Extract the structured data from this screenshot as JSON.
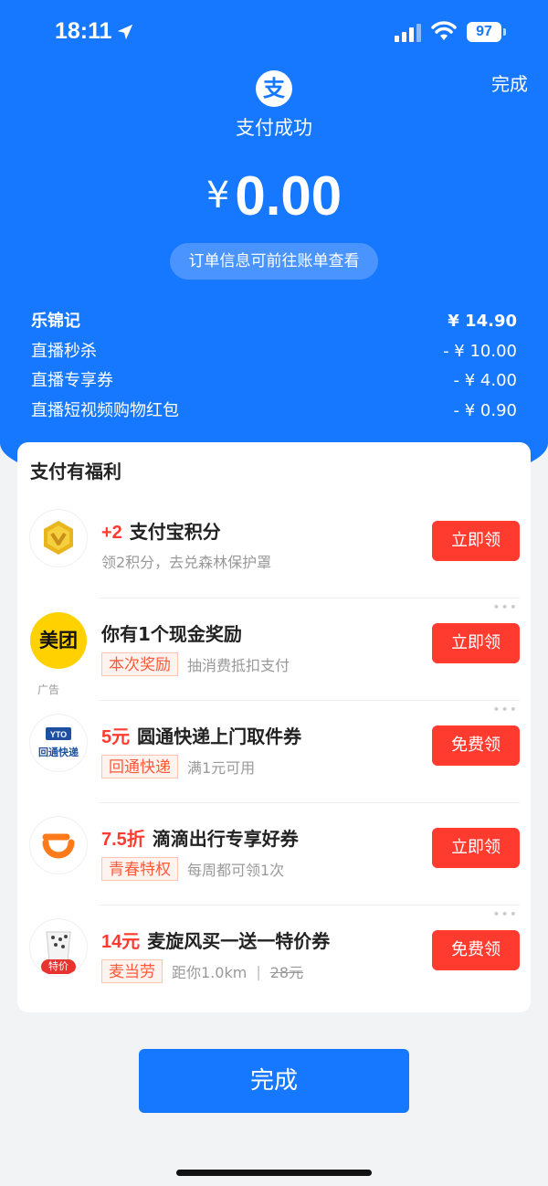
{
  "status_bar": {
    "time": "18:11",
    "battery": "97"
  },
  "header": {
    "done_label": "完成",
    "logo_char": "支",
    "title": "支付成功",
    "currency": "¥",
    "amount": "0.00",
    "bill_hint": "订单信息可前往账单查看"
  },
  "breakdown": [
    {
      "label": "乐锦记",
      "value": "¥ 14.90"
    },
    {
      "label": "直播秒杀",
      "value": "- ¥ 10.00"
    },
    {
      "label": "直播专享券",
      "value": "- ¥ 4.00"
    },
    {
      "label": "直播短视频购物红包",
      "value": "- ¥ 0.90"
    }
  ],
  "benefits": {
    "title": "支付有福利",
    "items": [
      {
        "highlight": "+2",
        "title": "支付宝积分",
        "sub": "领2积分，去兑森林保护罩",
        "button": "立即领",
        "icon": "alipay-points-icon"
      },
      {
        "logo_text": "美团",
        "ad_label": "广告",
        "title": "你有1个现金奖励",
        "tag": "本次奖励",
        "sub": "抽消费抵扣支付",
        "button": "立即领",
        "icon": "meituan-logo"
      },
      {
        "logo_text": "回通快递",
        "highlight": "5元",
        "title": "圆通快递上门取件券",
        "tag": "回通快递",
        "sub": "满1元可用",
        "button": "免费领",
        "icon": "yto-logo"
      },
      {
        "highlight": "7.5折",
        "title": "滴滴出行专享好券",
        "tag": "青春特权",
        "sub": "每周都可领1次",
        "button": "立即领",
        "icon": "didi-logo"
      },
      {
        "logo_text": "特价",
        "highlight": "14元",
        "title": "麦旋风买一送一特价券",
        "tag": "麦当劳",
        "sub": "距你1.0km",
        "price_old": "28元",
        "button": "免费领",
        "icon": "mcflurry-image"
      }
    ]
  },
  "finish_button": "完成",
  "colors": {
    "primary": "#1677ff",
    "accent_red": "#ff3b30"
  }
}
